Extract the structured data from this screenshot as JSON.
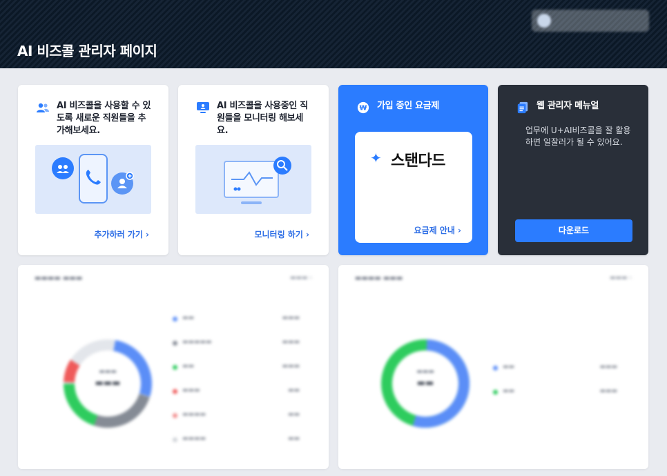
{
  "header": {
    "title": "AI 비즈콜 관리자 페이지"
  },
  "user": {
    "name": ""
  },
  "cards": {
    "add": {
      "text": "AI 비즈콜을 사용할 수 있도록 새로운 직원들을 추가해보세요.",
      "link": "추가하러 가기 ›"
    },
    "monitor": {
      "text": "AI 비즈콜을 사용중인 직원들을 모니터링 해보세요.",
      "link": "모니터링 하기 ›"
    },
    "plan": {
      "title": "가입 중인 요금제",
      "name": "스탠다드",
      "link": "요금제 안내 ›"
    },
    "manual": {
      "title": "웹 관리자 메뉴얼",
      "desc": "업무에 U+AI비즈콜을 잘 활용하면 일잘러가 될 수 있어요.",
      "button": "다운로드"
    }
  },
  "colors": {
    "accent": "#2b7cff",
    "dark": "#292f39"
  }
}
